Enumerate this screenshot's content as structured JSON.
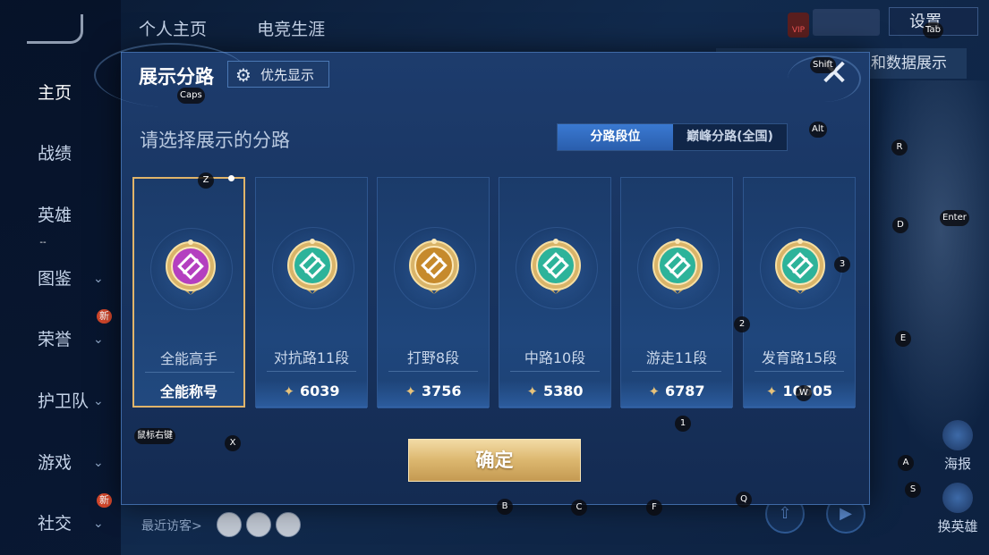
{
  "background": {
    "tabs": [
      "个人主页",
      "电竞生涯"
    ],
    "sidebar": [
      {
        "label": "主页",
        "active": true
      },
      {
        "label": "战绩"
      },
      {
        "label": "英雄"
      },
      {
        "label": "图鉴",
        "chevron": true
      },
      {
        "label": "荣誉",
        "chevron": true,
        "badge": "新"
      },
      {
        "label": "护卫队",
        "chevron": true
      },
      {
        "label": "游戏",
        "chevron": true
      },
      {
        "label": "社交",
        "chevron": true,
        "badge": "新"
      }
    ],
    "vip": "VIP",
    "settings_label": "设置",
    "banner_right": "生和数据展示",
    "recent_visitors": "最近访客>",
    "bottom_right": [
      {
        "label": "海报"
      },
      {
        "label": "换英雄"
      }
    ]
  },
  "modal": {
    "title": "展示分路",
    "priority_button": "优先显示",
    "subtitle": "请选择展示的分路",
    "segments": {
      "active": "分路段位",
      "inactive": "巅峰分路(全国)"
    },
    "confirm_label": "确定",
    "close_glyph": "✕",
    "cards": [
      {
        "name": "全能高手",
        "score": "全能称号",
        "selected": true,
        "emblem": "all-rounder-emblem",
        "color": "#b43fc0"
      },
      {
        "name": "对抗路11段",
        "score": "6039",
        "emblem": "clash-lane-emblem",
        "color": "#2db39a"
      },
      {
        "name": "打野8段",
        "score": "3756",
        "emblem": "jungle-emblem",
        "color": "#c68a2c"
      },
      {
        "name": "中路10段",
        "score": "5380",
        "emblem": "mid-lane-emblem",
        "color": "#2db39a"
      },
      {
        "name": "游走11段",
        "score": "6787",
        "emblem": "roam-emblem",
        "color": "#2db39a"
      },
      {
        "name": "发育路15段",
        "score": "10505",
        "emblem": "farm-lane-emblem",
        "color": "#2db39a"
      }
    ]
  },
  "key_hints": [
    "Tab",
    "Shift",
    "Caps",
    "Alt",
    "R",
    "D",
    "Enter",
    "3",
    "2",
    "E",
    "Z",
    "W",
    "1",
    "鼠标右键",
    "X",
    "A",
    "S",
    "B",
    "C",
    "F",
    "Q",
    "--"
  ]
}
